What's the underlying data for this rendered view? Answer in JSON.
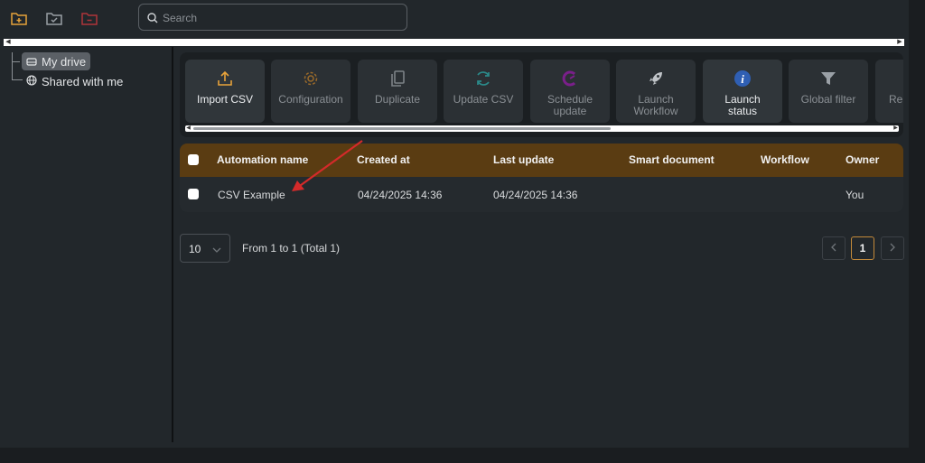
{
  "topbar": {
    "icons": [
      "folder-plus-icon",
      "folder-check-icon",
      "folder-minus-icon"
    ],
    "search_placeholder": "Search"
  },
  "sidebar": {
    "items": [
      {
        "label": "My drive",
        "icon": "drive-icon",
        "active": true
      },
      {
        "label": "Shared with me",
        "icon": "globe-icon",
        "active": false
      }
    ]
  },
  "toolbar": {
    "tools": [
      {
        "label": "Import CSV",
        "icon": "upload-icon",
        "enabled": true
      },
      {
        "label": "Configuration",
        "icon": "gear-icon",
        "enabled": false
      },
      {
        "label": "Duplicate",
        "icon": "copy-icon",
        "enabled": false
      },
      {
        "label": "Update CSV",
        "icon": "refresh-icon",
        "enabled": false
      },
      {
        "label": "Schedule update",
        "icon": "clock-icon",
        "enabled": false
      },
      {
        "label": "Launch Workflow",
        "icon": "rocket-icon",
        "enabled": false
      },
      {
        "label": "Launch status",
        "icon": "info-icon",
        "enabled": true
      },
      {
        "label": "Global filter",
        "icon": "filter-icon",
        "enabled": false
      },
      {
        "label": "Re",
        "icon": "",
        "enabled": false
      }
    ]
  },
  "table": {
    "columns": [
      "Automation name",
      "Created at",
      "Last update",
      "Smart document",
      "Workflow",
      "Owner"
    ],
    "rows": [
      {
        "name": "CSV Example",
        "created": "04/24/2025 14:36",
        "updated": "04/24/2025 14:36",
        "smart_document": "",
        "workflow": "",
        "owner": "You"
      }
    ]
  },
  "pagination": {
    "page_size": "10",
    "info": "From 1 to 1 (Total 1)",
    "current_page": "1"
  },
  "colors": {
    "accent": "#e8a33a",
    "header_bg": "#5a3c12",
    "annotation_arrow": "#d42a2a"
  }
}
